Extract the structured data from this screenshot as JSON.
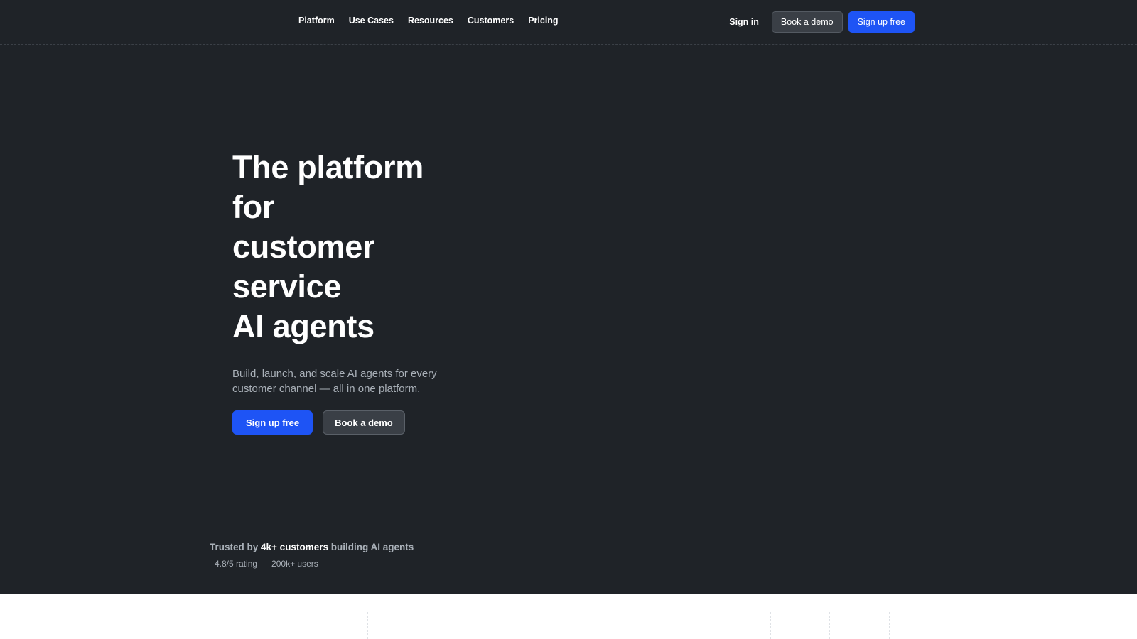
{
  "nav": {
    "links": [
      "Platform",
      "Use Cases",
      "Resources",
      "Customers",
      "Pricing"
    ],
    "sign_in": "Sign in",
    "book_demo": "Book a demo",
    "sign_up": "Sign up free"
  },
  "hero": {
    "headline_lines": [
      "The platform",
      "for",
      "customer",
      "service",
      "AI agents"
    ],
    "subtitle": "Build, launch, and scale AI agents for every customer channel — all in one platform.",
    "primary_cta": "Sign up free",
    "secondary_cta": "Book a demo"
  },
  "trust": {
    "prefix": "Trusted by",
    "highlight": "4k+ customers",
    "suffix": "building AI agents",
    "rating": "4.8/5 rating",
    "users": "200k+ users"
  },
  "colors": {
    "background": "#1f2328",
    "accent": "#1e54f5",
    "muted_text": "#a9b0b8",
    "button_dark": "#3a3f46"
  }
}
